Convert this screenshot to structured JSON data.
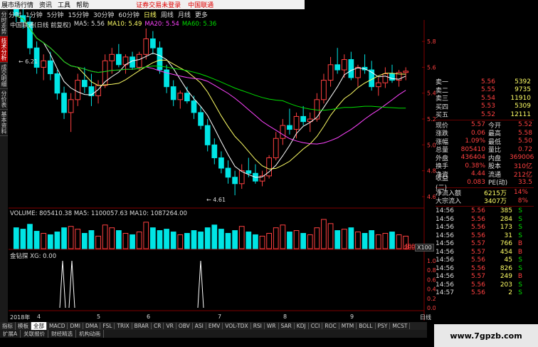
{
  "menubar": {
    "items": [
      "展市场行情",
      "资讯",
      "工具",
      "帮助"
    ],
    "warning": "证券交易未登录",
    "stock": "中国联通"
  },
  "periods": [
    "分时",
    "1分钟",
    "5分钟",
    "15分钟",
    "30分钟",
    "60分钟",
    "日线",
    "周线",
    "月线",
    "更多"
  ],
  "selected_period": "日线",
  "sidetabs": [
    "分时走势",
    "技术分析",
    "成交明细",
    "分价表",
    "基本资料"
  ],
  "ma_legend": {
    "name": "中国联通(日线 前复权)",
    "ma5": "MA5: 5.56",
    "ma10": "MA10: 5.49",
    "ma20": "MA20: 5.54",
    "ma60": "MA60: 5.36"
  },
  "volume_legend": "VOLUME: 805410.38  MA5: 1100057.63  MA10: 1087264.00",
  "indicator_legend": "金钻探  XG: 0.00",
  "annotations": {
    "high": "6.21",
    "low": "4.61"
  },
  "colors": {
    "up": "#ff4040",
    "down": "#00e5e5",
    "ma5": "#ffffff",
    "ma10": "#ffff66",
    "ma20": "#ff44ff",
    "ma60": "#00dd00"
  },
  "orderbook": [
    {
      "label": "卖一",
      "price": "5.56",
      "vol": "5392"
    },
    {
      "label": "卖二",
      "price": "5.55",
      "vol": "9735"
    },
    {
      "label": "卖三",
      "price": "5.54",
      "vol": "11910"
    },
    {
      "label": "买四",
      "price": "5.53",
      "vol": "5309"
    },
    {
      "label": "买五",
      "price": "5.52",
      "vol": "12111"
    }
  ],
  "quote": [
    {
      "l1": "现价",
      "v1": "5.57",
      "l2": "今开",
      "v2": "5.52"
    },
    {
      "l1": "涨跌",
      "v1": "0.06",
      "l2": "最高",
      "v2": "5.58"
    },
    {
      "l1": "涨幅",
      "v1": "1.09%",
      "l2": "最低",
      "v2": "5.50"
    },
    {
      "l1": "总量",
      "v1": "805410",
      "l2": "量比",
      "v2": "0.72"
    },
    {
      "l1": "外盘",
      "v1": "436404",
      "l2": "内盘",
      "v2": "369006"
    },
    {
      "l1": "换手",
      "v1": "0.38%",
      "l2": "股本",
      "v2": "310亿"
    },
    {
      "l1": "净资",
      "v1": "4.44",
      "l2": "流通",
      "v2": "212亿"
    },
    {
      "l1": "收益(二)",
      "v1": "0.083",
      "l2": "PE(动)",
      "v2": "33.5"
    }
  ],
  "flows": [
    {
      "label": "净流入额",
      "value": "6215万",
      "pct": "14%"
    },
    {
      "label": "大宗流入",
      "value": "3407万",
      "pct": "8%"
    }
  ],
  "ticks": [
    {
      "time": "14:56",
      "price": "5.56",
      "vol": "385",
      "side": "S"
    },
    {
      "time": "14:56",
      "price": "5.56",
      "vol": "284",
      "side": "S"
    },
    {
      "time": "14:56",
      "price": "5.56",
      "vol": "173",
      "side": "S"
    },
    {
      "time": "14:56",
      "price": "5.56",
      "vol": "31",
      "side": "S"
    },
    {
      "time": "14:56",
      "price": "5.57",
      "vol": "766",
      "side": "B"
    },
    {
      "time": "14:56",
      "price": "5.57",
      "vol": "454",
      "side": "B"
    },
    {
      "time": "14:56",
      "price": "5.56",
      "vol": "45",
      "side": "S"
    },
    {
      "time": "14:56",
      "price": "5.56",
      "vol": "826",
      "side": "S"
    },
    {
      "time": "14:56",
      "price": "5.57",
      "vol": "249",
      "side": "B"
    },
    {
      "time": "14:56",
      "price": "5.56",
      "vol": "203",
      "side": "S"
    },
    {
      "time": "14:57",
      "price": "5.56",
      "vol": "2",
      "side": "S"
    }
  ],
  "price_axis": [
    "5.80",
    "5.60",
    "5.40",
    "5.20",
    "5.00",
    "4.80",
    "4.60"
  ],
  "vol_axis": [
    "40000",
    "20000"
  ],
  "ind_axis": [
    "1.00",
    "0.80",
    "0.60",
    "0.40",
    "0.20",
    "0.00"
  ],
  "vol_unit": "X100",
  "xaxis": {
    "year": "2018年",
    "months": [
      "4",
      "5",
      "6",
      "7",
      "8",
      "9"
    ]
  },
  "day_label": "日线",
  "bottom_tabs": [
    "指标",
    "模板",
    "全部",
    "MACD",
    "DMI",
    "DMA",
    "FSL",
    "TRIX",
    "BRAR",
    "CR",
    "VR",
    "OBV",
    "ASI",
    "EMV",
    "VOL-TDX",
    "RSI",
    "WR",
    "SAR",
    "KDJ",
    "CCI",
    "ROC",
    "MTM",
    "BOLL",
    "PSY",
    "MCST"
  ],
  "bottom_tabs2": [
    "扩展A",
    "关联报价",
    "财经精选",
    "机构动画"
  ],
  "watermark": "www.7gpzb.com",
  "chart_data": {
    "type": "candlestick",
    "ylim": [
      4.55,
      5.9
    ],
    "candles": [
      [
        6.05,
        6.1,
        5.95,
        6.0
      ],
      [
        6.0,
        6.21,
        5.9,
        5.95
      ],
      [
        5.95,
        6.0,
        5.7,
        5.75
      ],
      [
        5.75,
        5.8,
        5.55,
        5.6
      ],
      [
        5.6,
        5.7,
        5.5,
        5.65
      ],
      [
        5.65,
        5.72,
        5.5,
        5.55
      ],
      [
        5.55,
        5.58,
        5.35,
        5.4
      ],
      [
        5.4,
        5.45,
        5.2,
        5.25
      ],
      [
        5.25,
        5.4,
        5.1,
        5.35
      ],
      [
        5.35,
        5.55,
        5.3,
        5.5
      ],
      [
        5.5,
        5.6,
        5.4,
        5.45
      ],
      [
        5.45,
        5.55,
        5.3,
        5.38
      ],
      [
        5.38,
        5.5,
        5.32,
        5.46
      ],
      [
        5.46,
        5.7,
        5.44,
        5.65
      ],
      [
        5.65,
        5.75,
        5.55,
        5.7
      ],
      [
        5.7,
        5.78,
        5.6,
        5.62
      ],
      [
        5.62,
        5.7,
        5.55,
        5.68
      ],
      [
        5.68,
        5.72,
        5.58,
        5.6
      ],
      [
        5.6,
        5.72,
        5.58,
        5.7
      ],
      [
        5.7,
        5.9,
        5.66,
        5.82
      ],
      [
        5.82,
        5.88,
        5.7,
        5.75
      ],
      [
        5.75,
        5.8,
        5.55,
        5.58
      ],
      [
        5.58,
        5.62,
        5.4,
        5.45
      ],
      [
        5.45,
        5.5,
        5.3,
        5.35
      ],
      [
        5.35,
        5.42,
        5.28,
        5.4
      ],
      [
        5.4,
        5.45,
        5.32,
        5.34
      ],
      [
        5.34,
        5.38,
        5.2,
        5.25
      ],
      [
        5.25,
        5.3,
        5.12,
        5.15
      ],
      [
        5.15,
        5.2,
        4.95,
        5.0
      ],
      [
        5.0,
        5.05,
        4.85,
        4.9
      ],
      [
        4.9,
        4.95,
        4.78,
        4.82
      ],
      [
        4.82,
        4.88,
        4.7,
        4.75
      ],
      [
        4.75,
        4.8,
        4.61,
        4.7
      ],
      [
        4.7,
        4.85,
        4.66,
        4.8
      ],
      [
        4.8,
        4.9,
        4.75,
        4.78
      ],
      [
        4.78,
        4.85,
        4.7,
        4.72
      ],
      [
        4.72,
        4.8,
        4.68,
        4.76
      ],
      [
        4.76,
        4.92,
        4.74,
        4.9
      ],
      [
        4.9,
        5.1,
        4.88,
        5.05
      ],
      [
        5.05,
        5.2,
        5.0,
        5.15
      ],
      [
        5.15,
        5.28,
        5.08,
        5.12
      ],
      [
        5.12,
        5.25,
        5.05,
        5.22
      ],
      [
        5.22,
        5.3,
        5.15,
        5.18
      ],
      [
        5.18,
        5.25,
        5.1,
        5.2
      ],
      [
        5.2,
        5.4,
        5.18,
        5.35
      ],
      [
        5.35,
        5.55,
        5.32,
        5.5
      ],
      [
        5.5,
        5.68,
        5.45,
        5.62
      ],
      [
        5.62,
        5.75,
        5.55,
        5.58
      ],
      [
        5.58,
        5.7,
        5.52,
        5.66
      ],
      [
        5.66,
        5.72,
        5.5,
        5.52
      ],
      [
        5.52,
        5.62,
        5.45,
        5.6
      ],
      [
        5.6,
        5.7,
        5.55,
        5.58
      ],
      [
        5.58,
        5.65,
        5.42,
        5.45
      ],
      [
        5.45,
        5.52,
        5.38,
        5.48
      ],
      [
        5.48,
        5.6,
        5.44,
        5.55
      ],
      [
        5.55,
        5.62,
        5.48,
        5.5
      ],
      [
        5.5,
        5.58,
        5.45,
        5.56
      ],
      [
        5.56,
        5.6,
        5.5,
        5.57
      ]
    ],
    "volumes": [
      30,
      28,
      35,
      25,
      22,
      20,
      24,
      30,
      32,
      28,
      22,
      26,
      18,
      34,
      30,
      26,
      22,
      20,
      24,
      38,
      30,
      26,
      28,
      24,
      20,
      22,
      26,
      24,
      30,
      34,
      28,
      22,
      26,
      32,
      24,
      20,
      18,
      22,
      30,
      34,
      24,
      26,
      22,
      20,
      30,
      42,
      36,
      26,
      28,
      30,
      24,
      22,
      26,
      20,
      22,
      24,
      20,
      18
    ],
    "signals": [
      4,
      8,
      16
    ],
    "signal_levels": [
      1,
      1,
      1
    ]
  }
}
